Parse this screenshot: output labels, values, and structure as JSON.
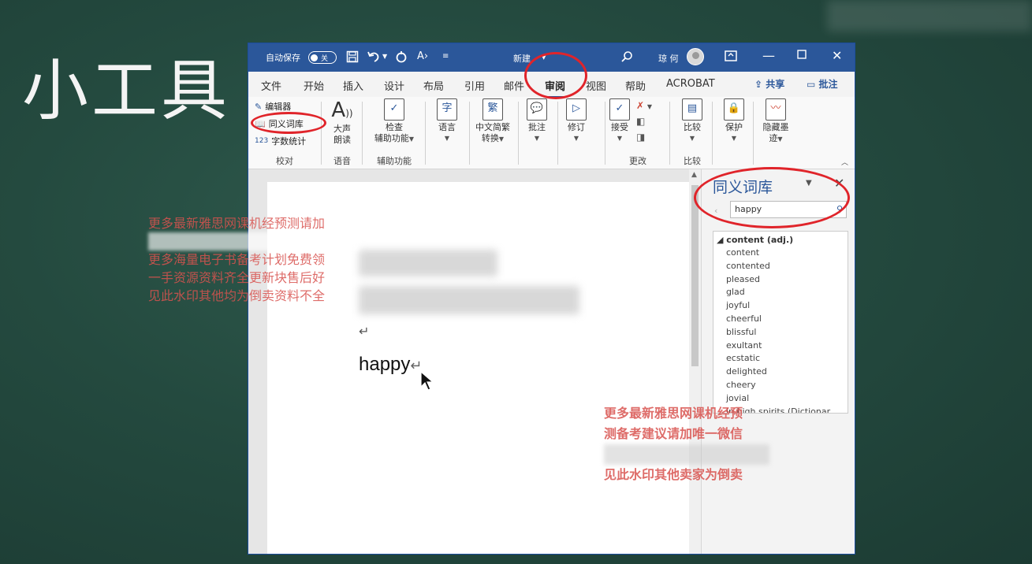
{
  "slide": {
    "title": "小工具"
  },
  "titlebar": {
    "autosave_label": "自动保存",
    "autosave_state": "关",
    "doc_name": "新建",
    "user_name": "琼 何",
    "bg_color": "#2b579a"
  },
  "menu": {
    "tabs": [
      "文件",
      "开始",
      "插入",
      "设计",
      "布局",
      "引用",
      "邮件",
      "审阅",
      "视图",
      "帮助",
      "ACROBAT"
    ],
    "active_tab": "审阅",
    "share": "共享",
    "comment": "批注"
  },
  "ribbon": {
    "proofing": {
      "spelling": "编辑器",
      "thesaurus": "同义词库",
      "wordcount": "字数统计",
      "label": "校对"
    },
    "speech": {
      "read_aloud_1": "大声",
      "read_aloud_2": "朗读",
      "label": "语音"
    },
    "accessibility": {
      "check_1": "检查",
      "check_2": "辅助功能",
      "label": "辅助功能"
    },
    "language": {
      "btn": "语言"
    },
    "chinese": {
      "btn_1": "中文简繁",
      "btn_2": "转换"
    },
    "comments": {
      "btn": "批注"
    },
    "tracking": {
      "btn": "修订"
    },
    "changes": {
      "accept": "接受",
      "label": "更改"
    },
    "compare": {
      "btn": "比较",
      "label": "比较"
    },
    "protect": {
      "btn": "保护"
    },
    "ink": {
      "btn_1": "隐藏墨",
      "btn_2": "迹"
    }
  },
  "document": {
    "word": "happy"
  },
  "thesaurus_pane": {
    "title": "同义词库",
    "search_value": "happy",
    "heading": "content (adj.)",
    "synonyms": [
      "content",
      "contented",
      "pleased",
      "glad",
      "joyful",
      "cheerful",
      "blissful",
      "exultant",
      "ecstatic",
      "delighted",
      "cheery",
      "jovial",
      "in high spirits (Dictionar"
    ]
  },
  "watermark_left": [
    "更多最新雅思网课机经预测请加",
    "",
    "更多海量电子书备考计划免费领",
    "一手资源资料齐全更新块售后好",
    "见此水印其他均为倒卖资料不全"
  ],
  "watermark_right": [
    "更多最新雅思网课机经预",
    "测备考建议请加唯一微信",
    "",
    "见此水印其他卖家为倒卖"
  ],
  "colors": {
    "accent": "#2b579a",
    "highlight_circle": "#e0242a",
    "watermark": "#d9534f",
    "background": "#244a3f"
  }
}
